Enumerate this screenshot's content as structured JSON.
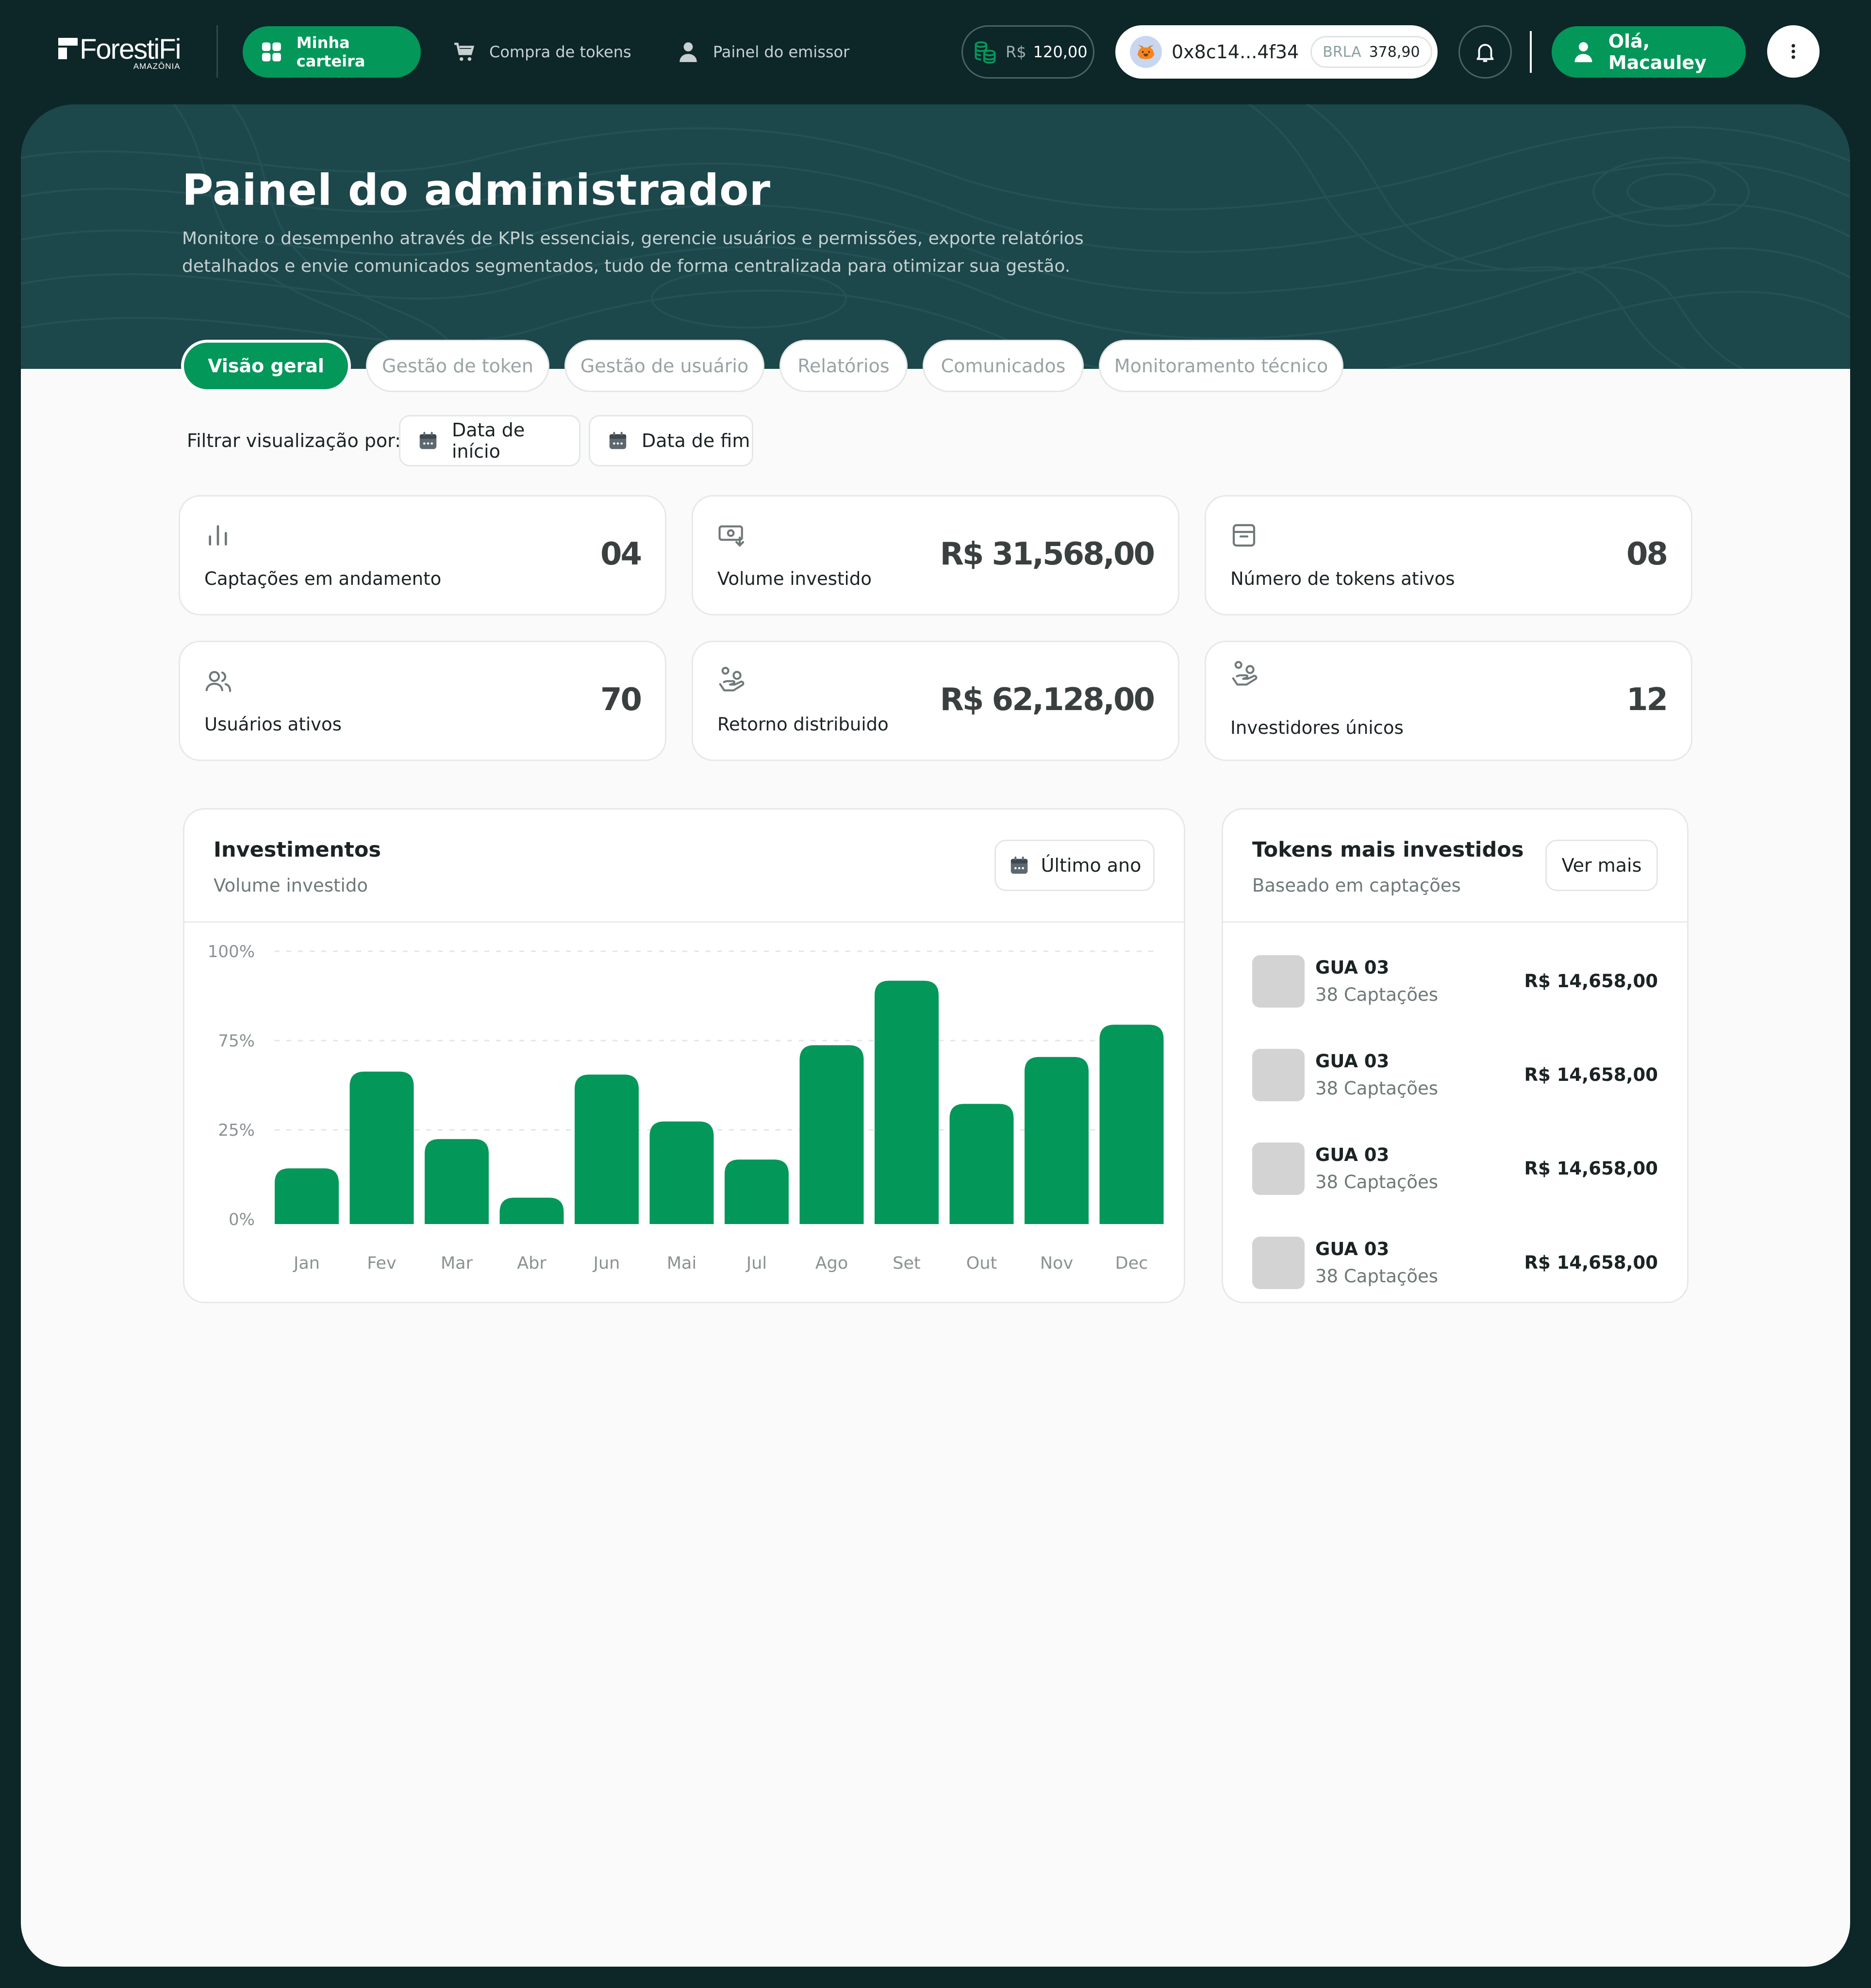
{
  "navbar": {
    "logo": "ForestiFi",
    "logo_sub": "AMAZÔNIA",
    "links": [
      {
        "label": "Minha carteira",
        "icon": "grid-icon",
        "active": true
      },
      {
        "label": "Compra de tokens",
        "icon": "cart-icon"
      },
      {
        "label": "Painel do emissor",
        "icon": "user-icon"
      }
    ],
    "balance": {
      "currency": "R$",
      "amount": "120,00"
    },
    "wallet": {
      "address": "0x8c14...4f34",
      "token": "BRLA",
      "token_amount": "378,90"
    },
    "greeting": "Olá, Macauley"
  },
  "header": {
    "title": "Painel do administrador",
    "description": "Monitore o desempenho através de KPIs essenciais, gerencie usuários e permissões, exporte relatórios detalhados e envie comunicados segmentados, tudo de forma centralizada para otimizar sua gestão."
  },
  "tabs": [
    {
      "label": "Visão geral",
      "active": true
    },
    {
      "label": "Gestão de token"
    },
    {
      "label": "Gestão de usuário"
    },
    {
      "label": "Relatórios"
    },
    {
      "label": "Comunicados"
    },
    {
      "label": "Monitoramento técnico"
    }
  ],
  "filters": {
    "label": "Filtrar visualização por:",
    "start": "Data de início",
    "end": "Data de fim"
  },
  "kpis": [
    {
      "label": "Captações em andamento",
      "value": "04",
      "icon": "bar-chart-icon"
    },
    {
      "label": "Volume investido",
      "value": "R$ 31,568,00",
      "icon": "money-icon"
    },
    {
      "label": "Número de tokens ativos",
      "value": "08",
      "icon": "archive-icon"
    },
    {
      "label": "Usuários ativos",
      "value": "70",
      "icon": "users-icon"
    },
    {
      "label": "Retorno distribuido",
      "value": "R$ 62,128,00",
      "icon": "hand-coins-icon"
    },
    {
      "label": "Investidores únicos",
      "value": "12",
      "icon": "hand-coins-icon"
    }
  ],
  "investments": {
    "title": "Investimentos",
    "subtitle": "Volume investido",
    "period_button": "Último ano"
  },
  "chart_data": {
    "type": "bar",
    "title": "Investimentos",
    "subtitle": "Volume investido",
    "categories": [
      "Jan",
      "Fev",
      "Mar",
      "Abr",
      "Jun",
      "Mai",
      "Jul",
      "Ago",
      "Set",
      "Out",
      "Nov",
      "Dec"
    ],
    "values": [
      19,
      52,
      29,
      9,
      51,
      35,
      22,
      61,
      83,
      41,
      57,
      68
    ],
    "y_ticks": [
      "100%",
      "75%",
      "25%",
      "0%"
    ],
    "grid": true,
    "color": "#03975a"
  },
  "top_tokens": {
    "title": "Tokens mais investidos",
    "subtitle": "Baseado em captações",
    "more_button": "Ver mais",
    "items": [
      {
        "name": "GUA 03",
        "sub": "38 Captações",
        "amount": "R$ 14,658,00"
      },
      {
        "name": "GUA 03",
        "sub": "38 Captações",
        "amount": "R$ 14,658,00"
      },
      {
        "name": "GUA 03",
        "sub": "38 Captações",
        "amount": "R$ 14,658,00"
      },
      {
        "name": "GUA 03",
        "sub": "38 Captações",
        "amount": "R$ 14,658,00"
      }
    ]
  }
}
